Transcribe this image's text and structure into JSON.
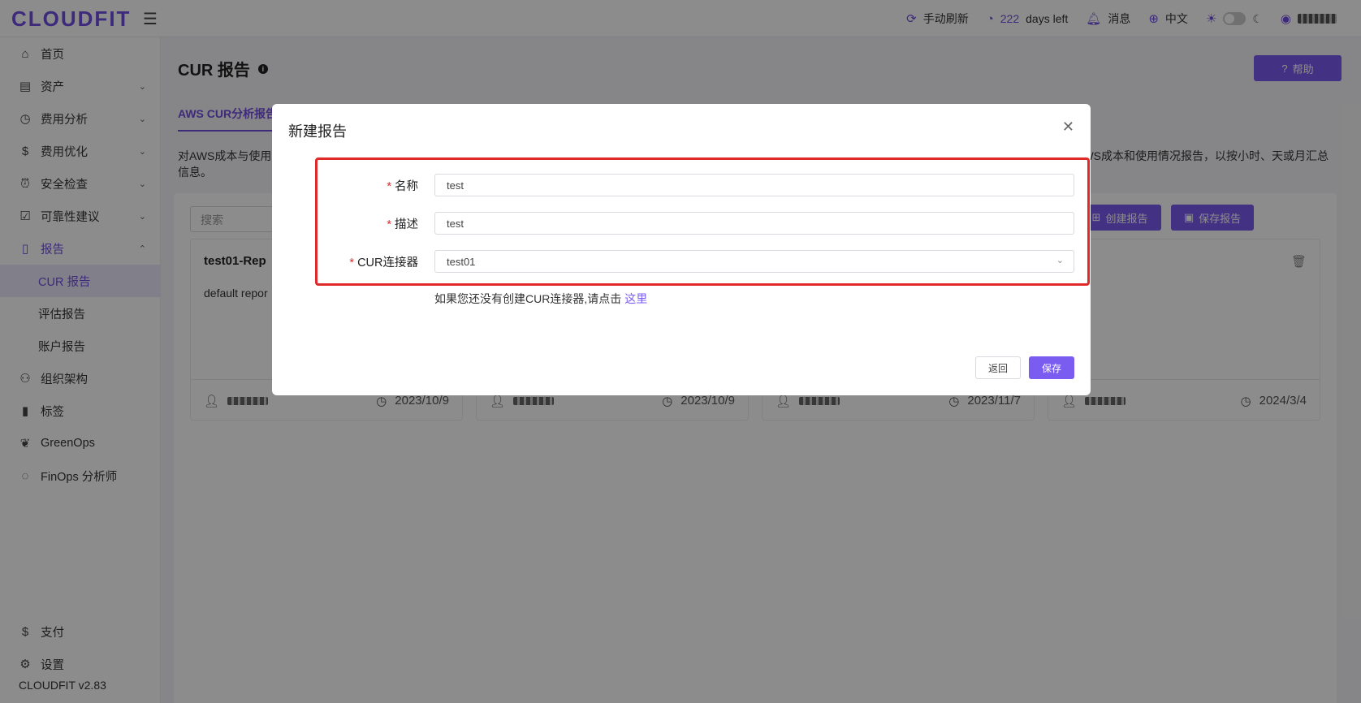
{
  "app": {
    "logo": "CLOUDFIT",
    "version": "CLOUDFIT v2.83"
  },
  "topbar": {
    "refresh": "手动刷新",
    "days_num": "222",
    "days_text": "days left",
    "messages": "消息",
    "language": "中文"
  },
  "sidebar": {
    "items": [
      {
        "label": "首页",
        "icon": "home-icon"
      },
      {
        "label": "资产",
        "icon": "assets-icon"
      },
      {
        "label": "费用分析",
        "icon": "dashboard-icon"
      },
      {
        "label": "费用优化",
        "icon": "dollar-icon"
      },
      {
        "label": "安全检查",
        "icon": "alarm-icon"
      },
      {
        "label": "可靠性建议",
        "icon": "checklist-icon"
      },
      {
        "label": "报告",
        "icon": "report-icon"
      },
      {
        "label": "组织架构",
        "icon": "org-icon"
      },
      {
        "label": "标签",
        "icon": "tag-icon"
      },
      {
        "label": "GreenOps",
        "icon": "leaf-icon"
      },
      {
        "label": "FinOps 分析师",
        "icon": "analyst-icon"
      }
    ],
    "report_sub": [
      "CUR 报告",
      "评估报告",
      "账户报告"
    ],
    "bottom": [
      {
        "label": "支付",
        "icon": "payment-icon"
      },
      {
        "label": "设置",
        "icon": "gear-icon"
      }
    ]
  },
  "main": {
    "title": "CUR 报告",
    "help": "帮助",
    "tab": "AWS CUR分析报告",
    "desc_left": "对AWS成本与使用",
    "desc_left2": "信息。",
    "desc_right": "WS成本和使用情况报告，以按小时、天或月汇总",
    "search_placeholder": "搜索",
    "create_btn": "创建报告",
    "save_btn": "保存报告",
    "cards": [
      {
        "title": "test01-Rep",
        "desc": "default repor",
        "date": "2023/10/9"
      },
      {
        "title": "",
        "desc": "",
        "date": "2023/10/9"
      },
      {
        "title": "",
        "desc": "",
        "date": "2023/11/7"
      },
      {
        "title": "",
        "desc": "",
        "date": "2024/3/4"
      }
    ]
  },
  "modal": {
    "title": "新建报告",
    "fields": [
      {
        "label": "名称",
        "value": "test"
      },
      {
        "label": "描述",
        "value": "test"
      },
      {
        "label": "CUR连接器",
        "value": "test01"
      }
    ],
    "hint": "如果您还没有创建CUR连接器,请点击",
    "hint_link": "这里",
    "back": "返回",
    "save": "保存"
  }
}
